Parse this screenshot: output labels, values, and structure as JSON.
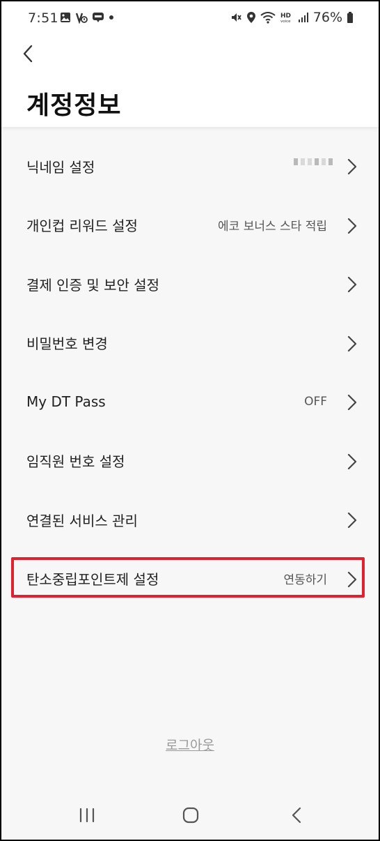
{
  "status_bar": {
    "time": "7:51",
    "battery": "76%",
    "icons_left": [
      "gallery-icon",
      "vpn-key-icon",
      "blog-icon",
      "notification-dot-icon"
    ],
    "icons_right": [
      "mute-icon",
      "location-icon",
      "wifi-icon",
      "hd-voice-icon",
      "signal-icon",
      "battery-icon"
    ]
  },
  "header": {
    "title": "계정정보"
  },
  "settings": {
    "items": [
      {
        "label": "닉네임 설정",
        "value": ""
      },
      {
        "label": "개인컵 리워드 설정",
        "value": "에코 보너스 스타 적립"
      },
      {
        "label": "결제 인증 및 보안 설정",
        "value": ""
      },
      {
        "label": "비밀번호 변경",
        "value": ""
      },
      {
        "label": "My DT Pass",
        "value": "OFF"
      },
      {
        "label": "임직원 번호 설정",
        "value": ""
      },
      {
        "label": "연결된 서비스 관리",
        "value": ""
      },
      {
        "label": "탄소중립포인트제 설정",
        "value": "연동하기"
      }
    ]
  },
  "footer": {
    "logout": "로그아웃"
  },
  "colors": {
    "highlight": "#e12030",
    "background": "#f7f7f7"
  }
}
